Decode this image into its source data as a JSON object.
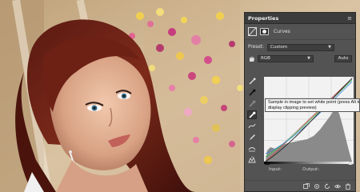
{
  "panel": {
    "tab_title": "Properties",
    "menu_icon": "panel-menu-icon",
    "adjustment_name": "Curves",
    "preset_label": "Preset:",
    "preset_value": "Custom",
    "channel_value": "RGB",
    "auto_label": "Auto",
    "input_label": "Input:",
    "output_label": "Output:",
    "tools": [
      "on-image-adjust-icon",
      "black-point-eyedropper-icon",
      "gray-point-eyedropper-icon",
      "white-point-eyedropper-icon",
      "curve-edit-icon",
      "pencil-icon",
      "smooth-icon",
      "clipping-warning-icon"
    ],
    "bottom_icons": [
      "clip-to-layer-icon",
      "view-previous-icon",
      "reset-icon",
      "visibility-icon",
      "delete-icon"
    ]
  },
  "tooltip": {
    "line1": "Sample in image to set white point (press Alt to",
    "line2": "display clipping preview)"
  },
  "colors": {
    "panel_bg": "#535353",
    "panel_header": "#3c3c3c",
    "curve_line": "#e0e0e0",
    "tooltip_bg": "#f4f4f4"
  }
}
